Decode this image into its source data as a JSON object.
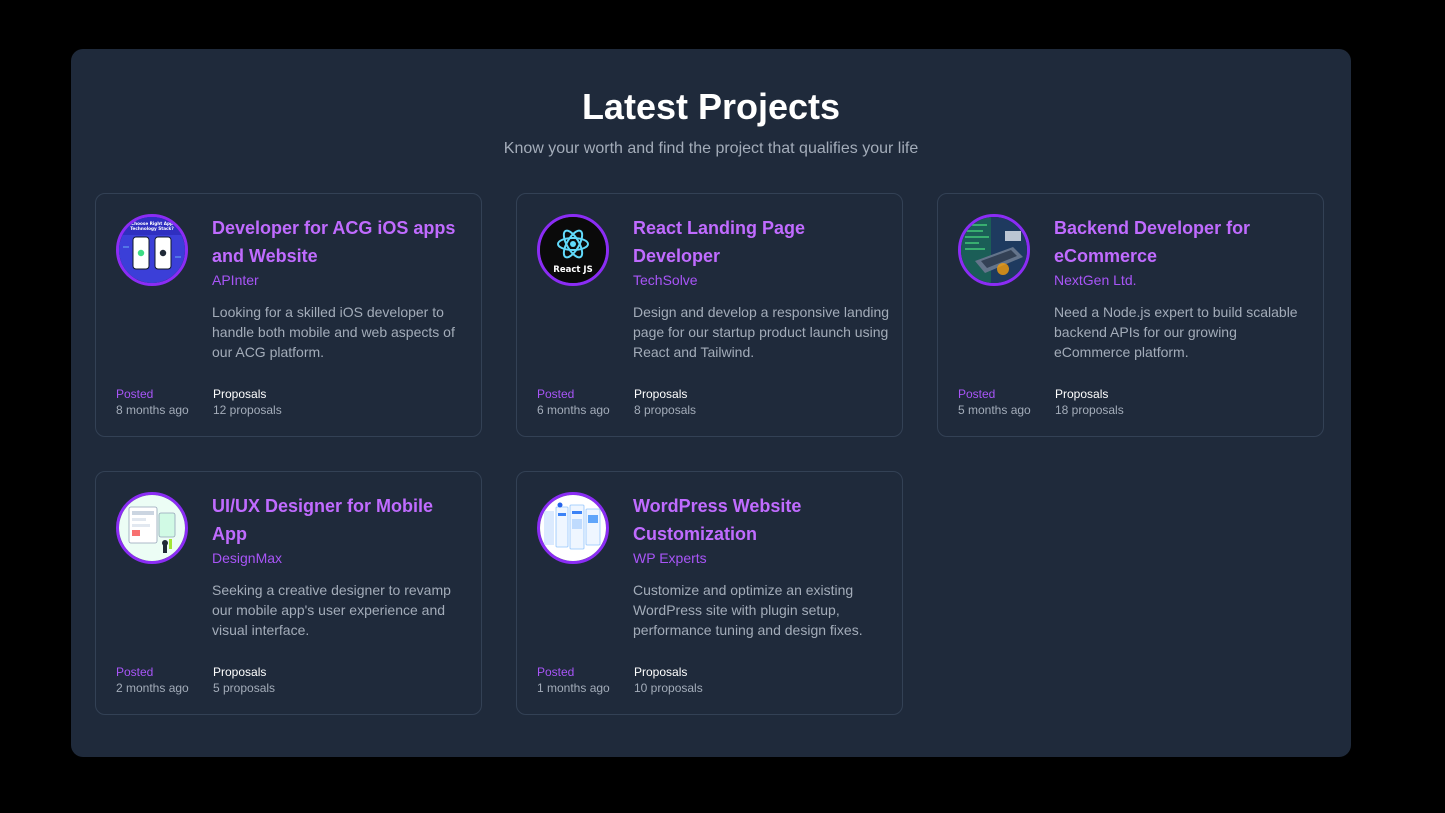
{
  "section": {
    "title": "Latest Projects",
    "subtitle": "Know your worth and find the project that qualifies your life"
  },
  "projects": [
    {
      "title": "Developer for ACG iOS apps and Website",
      "company": "APInter",
      "description": "Looking for a skilled iOS developer to handle both mobile and web aspects of our ACG platform.",
      "posted_label": "Posted",
      "posted": "8 months ago",
      "proposals_label": "Proposals",
      "proposals": "12 proposals",
      "image": "mobile-phones-image",
      "image_text": "Choose Right App Technology Stack?"
    },
    {
      "title": "React Landing Page Developer",
      "company": "TechSolve",
      "description": "Design and develop a responsive landing page for our startup product launch using React and Tailwind.",
      "posted_label": "Posted",
      "posted": "6 months ago",
      "proposals_label": "Proposals",
      "proposals": "8 proposals",
      "image": "react-logo-image",
      "image_text": "React JS"
    },
    {
      "title": "Backend Developer for eCommerce",
      "company": "NextGen Ltd.",
      "description": "Need a Node.js expert to build scalable backend APIs for our growing eCommerce platform.",
      "posted_label": "Posted",
      "posted": "5 months ago",
      "proposals_label": "Proposals",
      "proposals": "18 proposals",
      "image": "laptop-coding-image"
    },
    {
      "title": "UI/UX Designer for Mobile App",
      "company": "DesignMax",
      "description": "Seeking a creative designer to revamp our mobile app's user experience and visual interface.",
      "posted_label": "Posted",
      "posted": "2 months ago",
      "proposals_label": "Proposals",
      "proposals": "5 proposals",
      "image": "ux-wireframe-image"
    },
    {
      "title": "WordPress Website Customization",
      "company": "WP Experts",
      "description": "Customize and optimize an existing WordPress site with plugin setup, performance tuning and design fixes.",
      "posted_label": "Posted",
      "posted": "1 months ago",
      "proposals_label": "Proposals",
      "proposals": "10 proposals",
      "image": "website-mockup-image"
    }
  ],
  "colors": {
    "background": "#000000",
    "panel": "#1f2a3b",
    "accent": "#a855f7",
    "title_accent": "#c06bff",
    "card_border": "#334155"
  }
}
